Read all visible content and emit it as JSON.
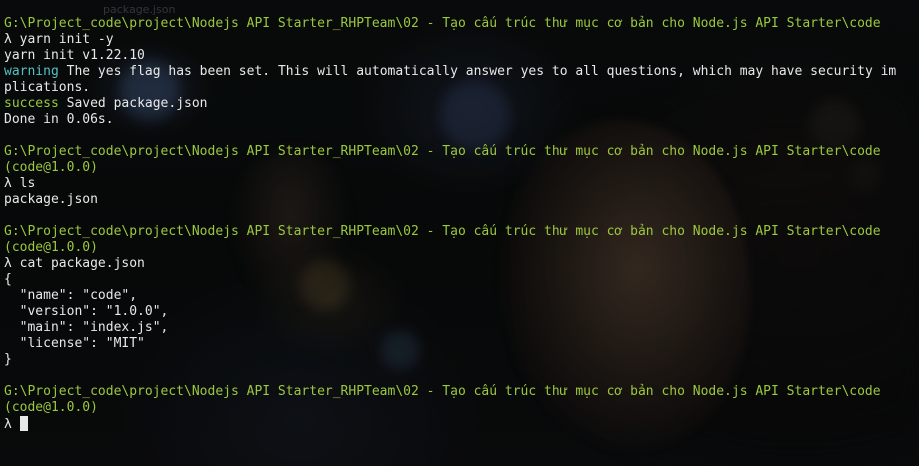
{
  "window": {
    "faint_tab_label": "package.json"
  },
  "session": [
    {
      "prompt_path": "G:\\Project_code\\project\\Nodejs API Starter_RHPTeam\\02 - Tạo cấu trúc thư mục cơ bản cho Node.js API Starter\\code",
      "package_tag": "",
      "command": "yarn init -y",
      "output": [
        {
          "text": "yarn init v1.22.10",
          "style": "white"
        },
        {
          "prefix": "warning",
          "prefix_style": "cyan",
          "text": " The yes flag has been set. This will automatically answer yes to all questions, which may have security im",
          "style": "white"
        },
        {
          "text": "plications.",
          "style": "white"
        },
        {
          "prefix": "success",
          "prefix_style": "green",
          "text": " Saved package.json",
          "style": "white"
        },
        {
          "text": "Done in 0.06s.",
          "style": "white"
        }
      ]
    },
    {
      "prompt_path": "G:\\Project_code\\project\\Nodejs API Starter_RHPTeam\\02 - Tạo cấu trúc thư mục cơ bản cho Node.js API Starter\\code",
      "package_tag": "(code@1.0.0)",
      "command": "ls",
      "output": [
        {
          "text": "package.json",
          "style": "white"
        }
      ]
    },
    {
      "prompt_path": "G:\\Project_code\\project\\Nodejs API Starter_RHPTeam\\02 - Tạo cấu trúc thư mục cơ bản cho Node.js API Starter\\code",
      "package_tag": "(code@1.0.0)",
      "command": "cat package.json",
      "output": [
        {
          "text": "{",
          "style": "white"
        },
        {
          "text": "  \"name\": \"code\",",
          "style": "white"
        },
        {
          "text": "  \"version\": \"1.0.0\",",
          "style": "white"
        },
        {
          "text": "  \"main\": \"index.js\",",
          "style": "white"
        },
        {
          "text": "  \"license\": \"MIT\"",
          "style": "white"
        },
        {
          "text": "}",
          "style": "white"
        }
      ]
    },
    {
      "prompt_path": "G:\\Project_code\\project\\Nodejs API Starter_RHPTeam\\02 - Tạo cấu trúc thư mục cơ bản cho Node.js API Starter\\code",
      "package_tag": "(code@1.0.0)",
      "command": "",
      "output": []
    }
  ],
  "prompt_symbol": "λ",
  "colors": {
    "path_green": "#9cc83c",
    "package_tag": "#9cc83c",
    "warning_cyan": "#55c1c6",
    "text_white": "#e8e8e8",
    "background": "#0b0d0c"
  }
}
